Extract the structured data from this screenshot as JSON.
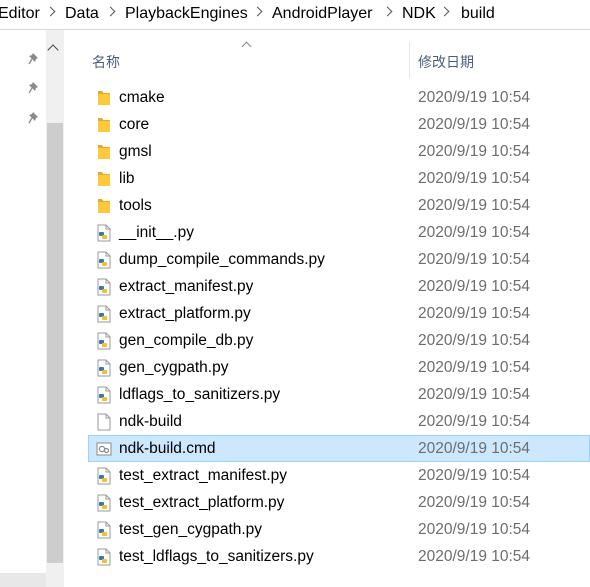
{
  "breadcrumb": [
    "Editor",
    "Data",
    "PlaybackEngines",
    "AndroidPlayer",
    "NDK",
    "build"
  ],
  "columns": {
    "name": "名称",
    "date_modified": "修改日期"
  },
  "files": [
    {
      "name": "cmake",
      "date": "2020/9/19 10:54",
      "icon": "folder-icon"
    },
    {
      "name": "core",
      "date": "2020/9/19 10:54",
      "icon": "folder-icon"
    },
    {
      "name": "gmsl",
      "date": "2020/9/19 10:54",
      "icon": "folder-icon"
    },
    {
      "name": "lib",
      "date": "2020/9/19 10:54",
      "icon": "folder-icon"
    },
    {
      "name": "tools",
      "date": "2020/9/19 10:54",
      "icon": "folder-icon"
    },
    {
      "name": "__init__.py",
      "date": "2020/9/19 10:54",
      "icon": "python-file-icon"
    },
    {
      "name": "dump_compile_commands.py",
      "date": "2020/9/19 10:54",
      "icon": "python-file-icon"
    },
    {
      "name": "extract_manifest.py",
      "date": "2020/9/19 10:54",
      "icon": "python-file-icon"
    },
    {
      "name": "extract_platform.py",
      "date": "2020/9/19 10:54",
      "icon": "python-file-icon"
    },
    {
      "name": "gen_compile_db.py",
      "date": "2020/9/19 10:54",
      "icon": "python-file-icon"
    },
    {
      "name": "gen_cygpath.py",
      "date": "2020/9/19 10:54",
      "icon": "python-file-icon"
    },
    {
      "name": "ldflags_to_sanitizers.py",
      "date": "2020/9/19 10:54",
      "icon": "python-file-icon"
    },
    {
      "name": "ndk-build",
      "date": "2020/9/19 10:54",
      "icon": "blank-file-icon"
    },
    {
      "name": "ndk-build.cmd",
      "date": "2020/9/19 10:54",
      "icon": "cmd-file-icon",
      "selected": true
    },
    {
      "name": "test_extract_manifest.py",
      "date": "2020/9/19 10:54",
      "icon": "python-file-icon"
    },
    {
      "name": "test_extract_platform.py",
      "date": "2020/9/19 10:54",
      "icon": "python-file-icon"
    },
    {
      "name": "test_gen_cygpath.py",
      "date": "2020/9/19 10:54",
      "icon": "python-file-icon"
    },
    {
      "name": "test_ldflags_to_sanitizers.py",
      "date": "2020/9/19 10:54",
      "icon": "python-file-icon"
    }
  ],
  "colors": {
    "selection_bg": "#cce8ff",
    "selection_border": "#99d1ff",
    "header_text": "#4c607a",
    "folder": "#ffc83d"
  }
}
